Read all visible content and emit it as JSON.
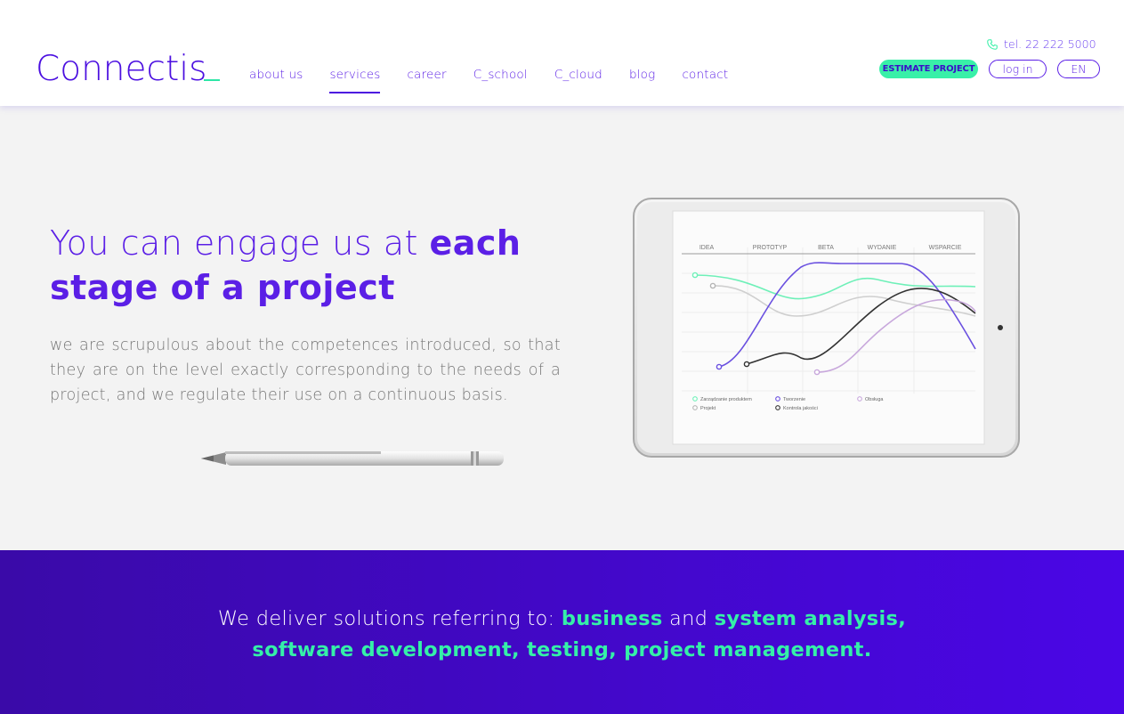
{
  "header": {
    "logo": "Connectis",
    "nav": [
      {
        "label": "about us",
        "active": false
      },
      {
        "label": "services",
        "active": true
      },
      {
        "label": "career",
        "active": false
      },
      {
        "label": "C_school",
        "active": false
      },
      {
        "label": "C_cloud",
        "active": false
      },
      {
        "label": "blog",
        "active": false
      },
      {
        "label": "contact",
        "active": false
      }
    ],
    "phone": "tel. 22 222 5000",
    "estimate_label": "ESTIMATE PROJECT",
    "login_label": "log in",
    "lang_label": "EN"
  },
  "hero": {
    "title_light": "You can engage us at ",
    "title_bold": "each stage of a project",
    "description": "we are scrupulous about the competences introduced, so that they are on the level exactly corresponding to the needs of a project, and we regulate their use on a continuous basis."
  },
  "chart_data": {
    "type": "line",
    "categories": [
      "IDEA",
      "PROTOTYP",
      "BETA",
      "WYDANIE",
      "WSPARCIE"
    ],
    "legend": [
      "Zarządzanie produktem",
      "Projekt",
      "Tworzenie",
      "Kontrola jakości",
      "Obsługa"
    ]
  },
  "band": {
    "intro": "We deliver solutions referring to: ",
    "h1": "business",
    "and": " and ",
    "h2": "system analysis,",
    "h3": "software development, testing, project management."
  },
  "colors": {
    "brand": "#5b1fe6",
    "accent": "#39f0a8",
    "band_start": "#3a0aa8",
    "band_end": "#4a06e6"
  }
}
